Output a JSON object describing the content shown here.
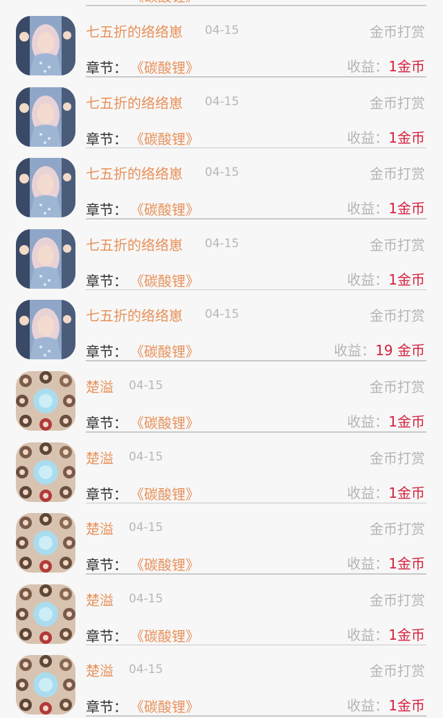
{
  "labels": {
    "gift_type": "金币打赏",
    "chapter_prefix": "章节：",
    "earnings_prefix": "收益："
  },
  "partial_top": {
    "chapter_title": "《碳酸锂》"
  },
  "records": [
    {
      "user": "七五折的络络崽",
      "date": "04-15",
      "chapter": "《碳酸锂》",
      "earnings": "1金币",
      "avatar_icon": "girl-portrait-avatar"
    },
    {
      "user": "七五折的络络崽",
      "date": "04-15",
      "chapter": "《碳酸锂》",
      "earnings": "1金币",
      "avatar_icon": "girl-portrait-avatar"
    },
    {
      "user": "七五折的络络崽",
      "date": "04-15",
      "chapter": "《碳酸锂》",
      "earnings": "1金币",
      "avatar_icon": "girl-portrait-avatar"
    },
    {
      "user": "七五折的络络崽",
      "date": "04-15",
      "chapter": "《碳酸锂》",
      "earnings": "1金币",
      "avatar_icon": "girl-portrait-avatar"
    },
    {
      "user": "七五折的络络崽",
      "date": "04-15",
      "chapter": "《碳酸锂》",
      "earnings": "19 金币",
      "avatar_icon": "girl-portrait-avatar"
    },
    {
      "user": "楚溢",
      "date": "04-15",
      "chapter": "《碳酸锂》",
      "earnings": "1金币",
      "avatar_icon": "group-circle-avatar"
    },
    {
      "user": "楚溢",
      "date": "04-15",
      "chapter": "《碳酸锂》",
      "earnings": "1金币",
      "avatar_icon": "group-circle-avatar"
    },
    {
      "user": "楚溢",
      "date": "04-15",
      "chapter": "《碳酸锂》",
      "earnings": "1金币",
      "avatar_icon": "group-circle-avatar"
    },
    {
      "user": "楚溢",
      "date": "04-15",
      "chapter": "《碳酸锂》",
      "earnings": "1金币",
      "avatar_icon": "group-circle-avatar"
    },
    {
      "user": "楚溢",
      "date": "04-15",
      "chapter": "《碳酸锂》",
      "earnings": "1金币",
      "avatar_icon": "group-circle-avatar"
    }
  ],
  "colors": {
    "background": "#f7f7f7",
    "username": "#e8915a",
    "earnings_value": "#d6203f",
    "muted_text": "#b4b4b4",
    "label_text": "#333333",
    "divider": "#c9c9c9"
  }
}
